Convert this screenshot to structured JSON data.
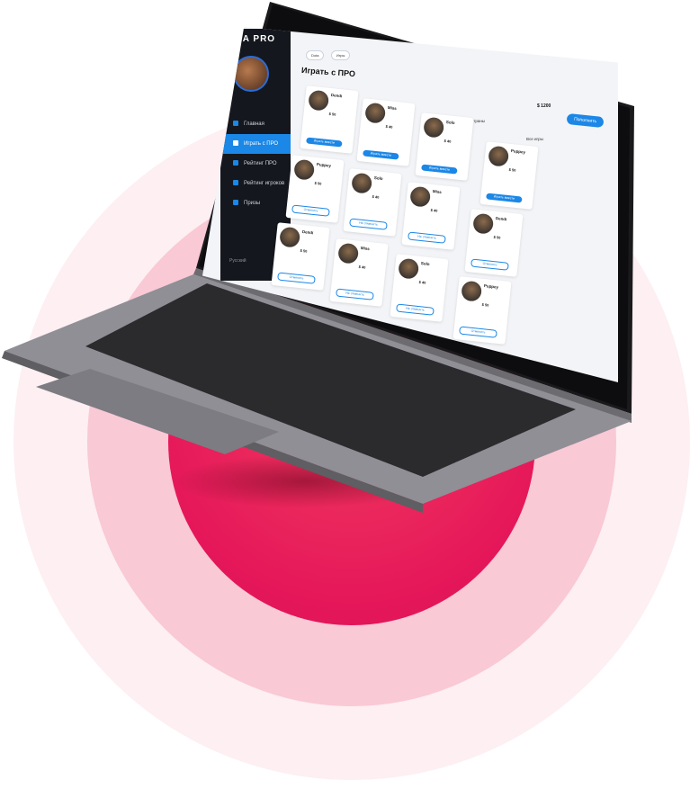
{
  "sidebar": {
    "logo": "PLA PRO",
    "items": [
      {
        "label": "Главная",
        "active": false
      },
      {
        "label": "Играть с ПРО",
        "active": true
      },
      {
        "label": "Рейтинг ПРО",
        "active": false
      },
      {
        "label": "Рейтинг игроков",
        "active": false
      },
      {
        "label": "Призы",
        "active": false
      }
    ],
    "lang": "Русский"
  },
  "main": {
    "pills": [
      "Dota",
      "Игры"
    ],
    "title": "Играть с ПРО",
    "balance": "$ 1200",
    "topup": "Пополнить",
    "filter_all_servers": "Все страны",
    "filter_all_games": "Все игры"
  },
  "cards": [
    {
      "name": "Dendi",
      "price": "$ 50",
      "button": "Играть вместе"
    },
    {
      "name": "Miss",
      "price": "$ 40",
      "button": "Играть вместе"
    },
    {
      "name": "Solo",
      "price": "$ 40",
      "button": "Играть вместе"
    },
    {
      "name": "Puppey",
      "price": "$ 50",
      "button": "Играть вместе"
    },
    {
      "name": "Puppey",
      "price": "$ 50",
      "button": "Отменить"
    },
    {
      "name": "Solo",
      "price": "$ 40",
      "button": "Не отменить"
    },
    {
      "name": "Miss",
      "price": "$ 40",
      "button": "Не отменить"
    },
    {
      "name": "Dendi",
      "price": "$ 50",
      "button": "Отменить"
    },
    {
      "name": "Dendi",
      "price": "$ 50",
      "button": "Отменить"
    },
    {
      "name": "Miss",
      "price": "$ 40",
      "button": "Не отменить"
    },
    {
      "name": "Solo",
      "price": "$ 40",
      "button": "Не отменить"
    },
    {
      "name": "Puppey",
      "price": "$ 50",
      "button": "Отменить"
    }
  ],
  "colors": {
    "accent": "#1b87e6",
    "sidebar_bg": "#14171d",
    "ring_inner": "#e5175a",
    "ring_mid": "#f9c9d5",
    "ring_outer": "#fdeff2"
  }
}
